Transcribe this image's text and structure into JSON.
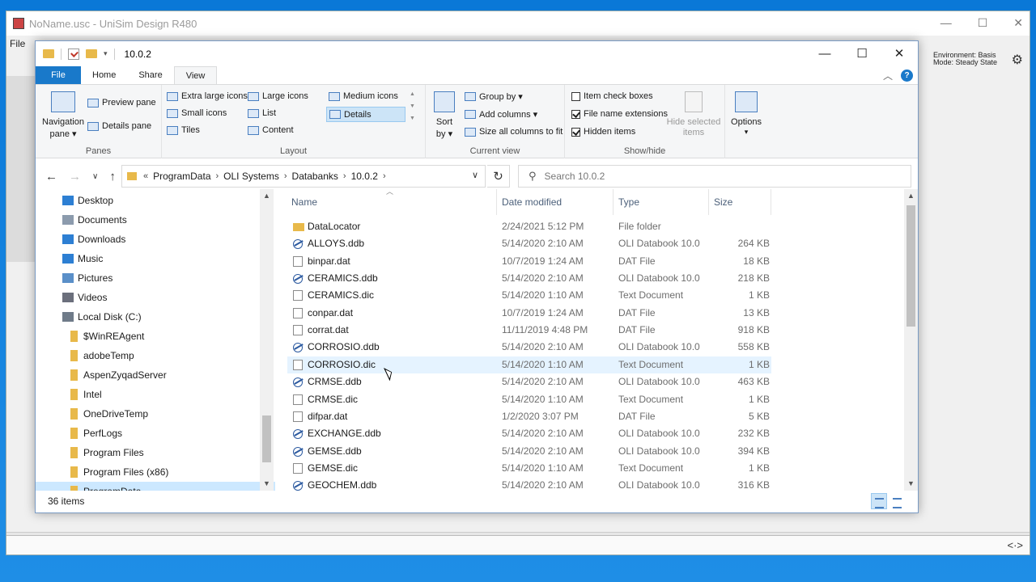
{
  "background_app": {
    "title": "NoName.usc - UniSim Design R480",
    "menu_first": "File",
    "status_environment": "Environment: Basis",
    "status_mode": "Mode: Steady State"
  },
  "window": {
    "title": "10.0.2",
    "minimize": "—",
    "maximize": "☐",
    "close": "✕"
  },
  "tabs": [
    {
      "label": "File"
    },
    {
      "label": "Home"
    },
    {
      "label": "Share"
    },
    {
      "label": "View"
    }
  ],
  "ribbon": {
    "panes": {
      "label": "Panes",
      "navigation_pane": "Navigation",
      "navigation_pane2": "pane ▾",
      "preview_pane": "Preview pane",
      "details_pane": "Details pane"
    },
    "layout": {
      "label": "Layout",
      "extra_large_icons": "Extra large icons",
      "large_icons": "Large icons",
      "medium_icons": "Medium icons",
      "small_icons": "Small icons",
      "list": "List",
      "details": "Details",
      "tiles": "Tiles",
      "content": "Content"
    },
    "current_view": {
      "label": "Current view",
      "sort_by": "Sort",
      "sort_by2": "by ▾",
      "group_by": "Group by ▾",
      "add_columns": "Add columns ▾",
      "size_all_columns": "Size all columns to fit"
    },
    "show_hide": {
      "label": "Show/hide",
      "item_check_boxes": "Item check boxes",
      "file_name_extensions": "File name extensions",
      "hidden_items": "Hidden items",
      "hide_selected": "Hide selected",
      "hide_selected2": "items",
      "item_check_boxes_checked": false,
      "file_name_extensions_checked": true,
      "hidden_items_checked": true
    },
    "options": {
      "label": "Options",
      "arrow": "▾"
    }
  },
  "address": {
    "breadcrumbs": [
      "ProgramData",
      "OLI Systems",
      "Databanks",
      "10.0.2"
    ],
    "search_placeholder": "Search 10.0.2"
  },
  "nav_pane": [
    {
      "label": "Desktop",
      "icon": "desktop-icon",
      "indent": 1
    },
    {
      "label": "Documents",
      "icon": "documents-icon",
      "indent": 1
    },
    {
      "label": "Downloads",
      "icon": "downloads-icon",
      "indent": 1
    },
    {
      "label": "Music",
      "icon": "music-icon",
      "indent": 1
    },
    {
      "label": "Pictures",
      "icon": "pictures-icon",
      "indent": 1
    },
    {
      "label": "Videos",
      "icon": "videos-icon",
      "indent": 1
    },
    {
      "label": "Local Disk (C:)",
      "icon": "drive-icon",
      "indent": 1
    },
    {
      "label": "$WinREAgent",
      "icon": "folder-icon",
      "indent": 2
    },
    {
      "label": "adobeTemp",
      "icon": "folder-icon",
      "indent": 2
    },
    {
      "label": "AspenZyqadServer",
      "icon": "folder-icon",
      "indent": 2
    },
    {
      "label": "Intel",
      "icon": "folder-icon",
      "indent": 2
    },
    {
      "label": "OneDriveTemp",
      "icon": "folder-icon",
      "indent": 2
    },
    {
      "label": "PerfLogs",
      "icon": "folder-icon",
      "indent": 2
    },
    {
      "label": "Program Files",
      "icon": "folder-icon",
      "indent": 2
    },
    {
      "label": "Program Files (x86)",
      "icon": "folder-icon",
      "indent": 2
    },
    {
      "label": "ProgramData",
      "icon": "folder-icon",
      "indent": 2,
      "selected": true
    }
  ],
  "columns": {
    "name": "Name",
    "date_modified": "Date modified",
    "type": "Type",
    "size": "Size"
  },
  "files": [
    {
      "name": "DataLocator",
      "date": "2/24/2021 5:12 PM",
      "type": "File folder",
      "size": "",
      "kind": "folder"
    },
    {
      "name": "ALLOYS.ddb",
      "date": "5/14/2020 2:10 AM",
      "type": "OLI Databook 10.0",
      "size": "264 KB",
      "kind": "db"
    },
    {
      "name": "binpar.dat",
      "date": "10/7/2019 1:24 AM",
      "type": "DAT File",
      "size": "18 KB",
      "kind": "doc"
    },
    {
      "name": "CERAMICS.ddb",
      "date": "5/14/2020 2:10 AM",
      "type": "OLI Databook 10.0",
      "size": "218 KB",
      "kind": "db"
    },
    {
      "name": "CERAMICS.dic",
      "date": "5/14/2020 1:10 AM",
      "type": "Text Document",
      "size": "1 KB",
      "kind": "doc"
    },
    {
      "name": "conpar.dat",
      "date": "10/7/2019 1:24 AM",
      "type": "DAT File",
      "size": "13 KB",
      "kind": "doc"
    },
    {
      "name": "corrat.dat",
      "date": "11/11/2019 4:48 PM",
      "type": "DAT File",
      "size": "918 KB",
      "kind": "doc"
    },
    {
      "name": "CORROSIO.ddb",
      "date": "5/14/2020 2:10 AM",
      "type": "OLI Databook 10.0",
      "size": "558 KB",
      "kind": "db"
    },
    {
      "name": "CORROSIO.dic",
      "date": "5/14/2020 1:10 AM",
      "type": "Text Document",
      "size": "1 KB",
      "kind": "doc",
      "hover": true
    },
    {
      "name": "CRMSE.ddb",
      "date": "5/14/2020 2:10 AM",
      "type": "OLI Databook 10.0",
      "size": "463 KB",
      "kind": "db"
    },
    {
      "name": "CRMSE.dic",
      "date": "5/14/2020 1:10 AM",
      "type": "Text Document",
      "size": "1 KB",
      "kind": "doc"
    },
    {
      "name": "difpar.dat",
      "date": "1/2/2020 3:07 PM",
      "type": "DAT File",
      "size": "5 KB",
      "kind": "doc"
    },
    {
      "name": "EXCHANGE.ddb",
      "date": "5/14/2020 2:10 AM",
      "type": "OLI Databook 10.0",
      "size": "232 KB",
      "kind": "db"
    },
    {
      "name": "GEMSE.ddb",
      "date": "5/14/2020 2:10 AM",
      "type": "OLI Databook 10.0",
      "size": "394 KB",
      "kind": "db"
    },
    {
      "name": "GEMSE.dic",
      "date": "5/14/2020 1:10 AM",
      "type": "Text Document",
      "size": "1 KB",
      "kind": "doc"
    },
    {
      "name": "GEOCHEM.ddb",
      "date": "5/14/2020 2:10 AM",
      "type": "OLI Databook 10.0",
      "size": "316 KB",
      "kind": "db"
    }
  ],
  "status": {
    "item_count": "36 items"
  },
  "colors": {
    "accent": "#1979ca",
    "desktop": "#0a78d7",
    "selection": "#cce8ff",
    "hover": "#e5f3ff"
  }
}
